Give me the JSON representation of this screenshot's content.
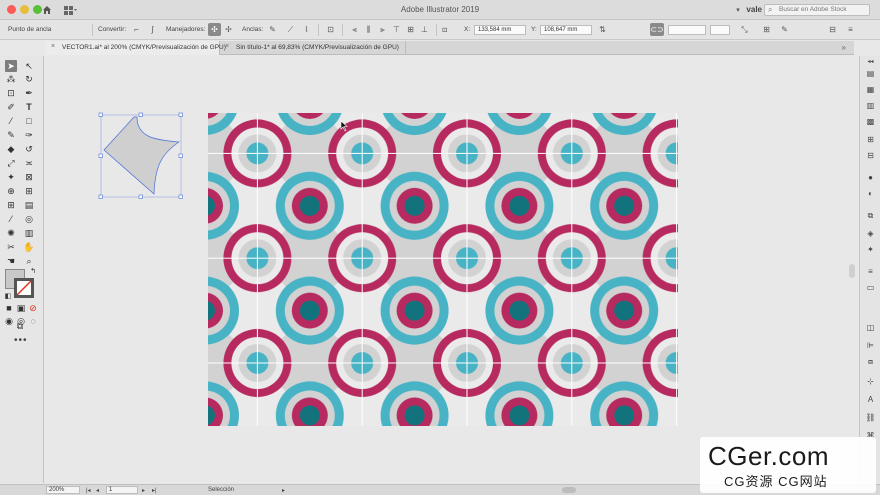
{
  "window": {
    "title": "Adobe Illustrator 2019",
    "user": "vale",
    "search_placeholder": "Buscar en Adobe Stock"
  },
  "control_bar": {
    "anchor_point": "Punto de ancla",
    "convert": "Convertir:",
    "handles": "Manejadores:",
    "anchors": "Anclas:",
    "x_label": "X:",
    "x_value": "133,584 mm",
    "y_label": "Y:",
    "y_value": "108,647 mm"
  },
  "tabs": [
    {
      "label": "VECTOR1.ai* al 200% (CMYK/Previsualización de GPU)",
      "active": true
    },
    {
      "label": "Sin título-1* al 69,83% (CMYK/Previsualización de GPU)",
      "active": false
    }
  ],
  "status_bar": {
    "zoom": "200%",
    "artboard": "1",
    "mode": "Selección"
  },
  "watermark": {
    "main": "CGer.com",
    "sub": "CG资源  CG网站"
  },
  "colors": {
    "magenta": "#b72a5f",
    "teal": "#47b3c4",
    "dark_teal": "#12737c",
    "light_gray": "#d2d2d2",
    "bg_gray": "#eaeaea",
    "selection": "#4a6ed8"
  },
  "icons": {
    "home": "home-icon",
    "workspace": "workspace-grid-icon",
    "search": "search-icon",
    "selection_tool": "arrow-icon"
  }
}
